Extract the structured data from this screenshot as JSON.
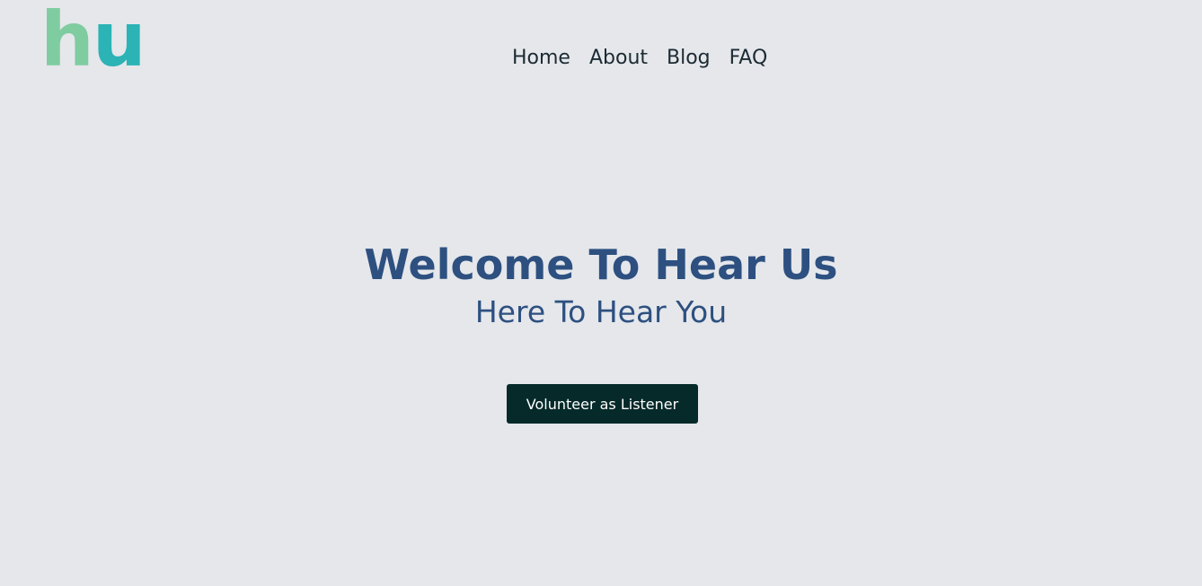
{
  "logo": {
    "letter1": "h",
    "letter2": "u",
    "colors": {
      "h": "#7fcca0",
      "u": "#2bb3b5"
    }
  },
  "nav": {
    "items": [
      {
        "label": "Home"
      },
      {
        "label": "About"
      },
      {
        "label": "Blog"
      },
      {
        "label": "FAQ"
      }
    ]
  },
  "hero": {
    "title": "Welcome To Hear Us",
    "subtitle": "Here To Hear You",
    "cta_label": "Volunteer as Listener"
  },
  "theme": {
    "background": "#e5e7eb",
    "heading_color": "#2d5080",
    "button_bg": "#052a29"
  }
}
